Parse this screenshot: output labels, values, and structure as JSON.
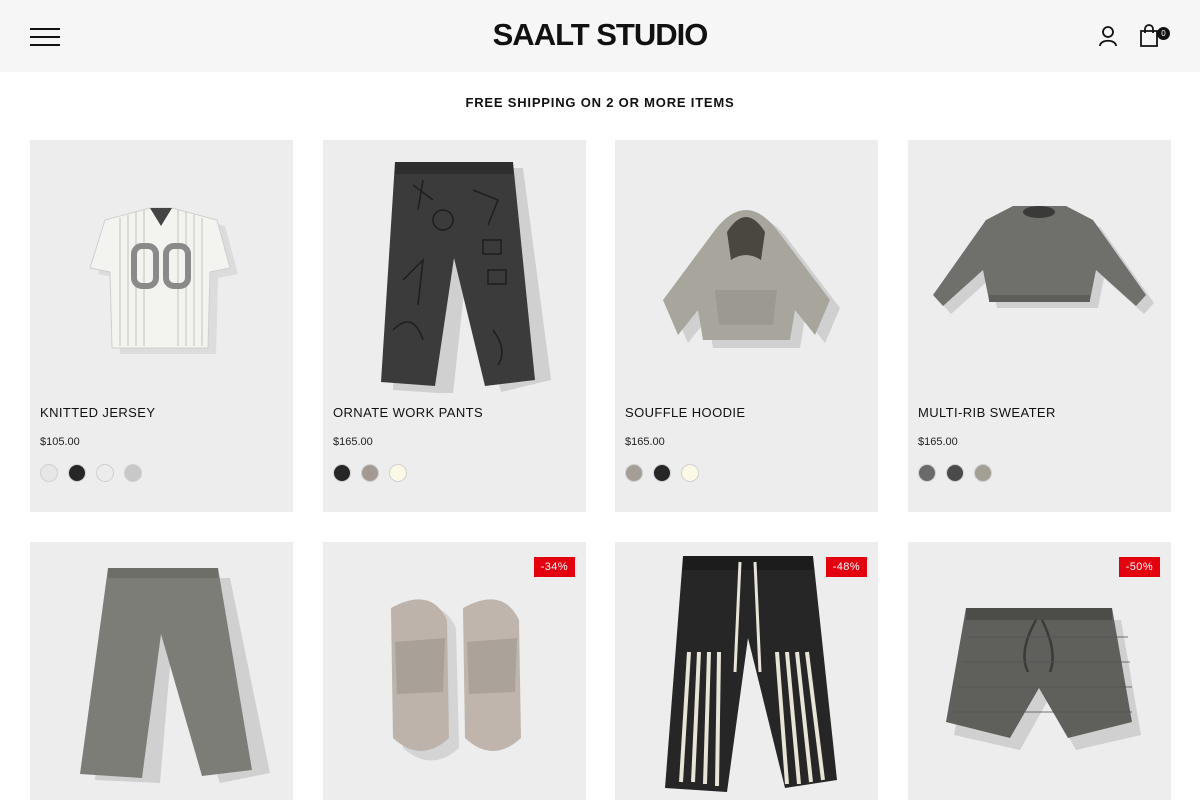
{
  "header": {
    "brand": "SAALT STUDIO",
    "cart_count": "0",
    "icons": {
      "menu": "hamburger-menu-icon",
      "account": "user-icon",
      "cart": "shopping-bag-icon"
    }
  },
  "announcement": "FREE SHIPPING ON 2 OR MORE ITEMS",
  "colors": {
    "header_bg": "#f6f6f6",
    "card_bg": "#ededed",
    "sale_badge": "#e3000f"
  },
  "products": [
    {
      "name": "KNITTED JERSEY",
      "price": "$105.00",
      "swatches": [
        "#e6e6e6",
        "#262626",
        "#ececec",
        "#c8c8c8"
      ]
    },
    {
      "name": "ORNATE WORK PANTS",
      "price": "$165.00",
      "swatches": [
        "#262626",
        "#a39b93",
        "#fbf9e6"
      ]
    },
    {
      "name": "SOUFFLE HOODIE",
      "price": "$165.00",
      "swatches": [
        "#a59e97",
        "#262626",
        "#fbf9e6"
      ]
    },
    {
      "name": "MULTI-RIB SWEATER",
      "price": "$165.00",
      "swatches": [
        "#6a6a6a",
        "#4a4a4a",
        "#a39f92"
      ]
    },
    {
      "name": "",
      "price": "",
      "badge": "",
      "swatches": []
    },
    {
      "name": "",
      "price": "",
      "badge": "-34%",
      "swatches": []
    },
    {
      "name": "",
      "price": "",
      "badge": "-48%",
      "swatches": []
    },
    {
      "name": "",
      "price": "",
      "badge": "-50%",
      "swatches": []
    }
  ]
}
